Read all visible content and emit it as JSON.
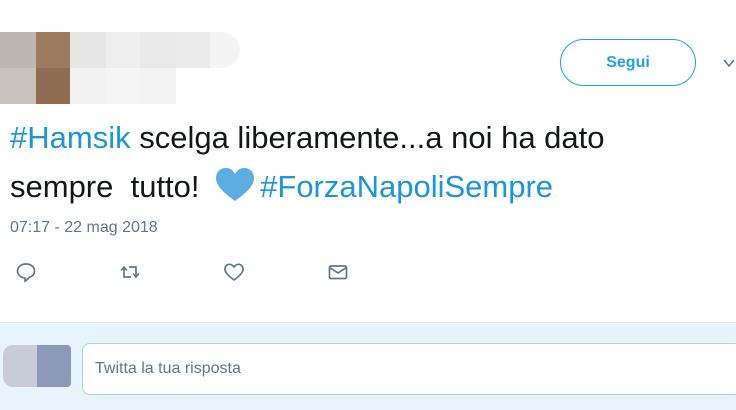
{
  "author": {
    "avatar_state": "pixelated"
  },
  "header": {
    "follow_label": "Segui",
    "menu_icon": "chevron-down-icon"
  },
  "tweet": {
    "hashtag_1": "#Hamsik",
    "text_line1": " scelga liberamente...a noi ha dato",
    "text_line2": "sempre  tutto! ",
    "emoji": "blue-heart",
    "hashtag_2": "#ForzaNapoliSempre",
    "timestamp": "07:17 - 22 mag 2018"
  },
  "actions": [
    {
      "name": "reply",
      "icon": "reply-icon"
    },
    {
      "name": "retweet",
      "icon": "retweet-icon"
    },
    {
      "name": "like",
      "icon": "heart-icon"
    },
    {
      "name": "direct-message",
      "icon": "mail-icon"
    }
  ],
  "reply_box": {
    "placeholder": "Twitta la tua risposta"
  },
  "colors": {
    "accent": "#1da1f2",
    "link": "#1b95e0",
    "text": "#14171a",
    "muted": "#657786",
    "emoji_heart": "#5dade2",
    "reply_bg": "#e8f4fb"
  }
}
